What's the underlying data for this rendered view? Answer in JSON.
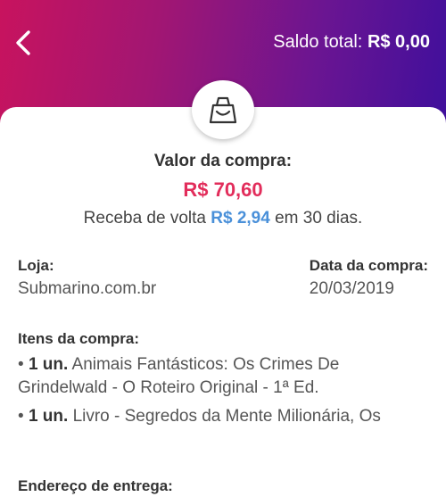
{
  "header": {
    "back_icon": "chevron-left-icon",
    "saldo_label": "Saldo total:",
    "saldo_value": "R$ 0,00",
    "gradient_colors": [
      "#c8135e",
      "#6a1592",
      "#3f0f9c"
    ]
  },
  "badge": {
    "icon": "shopping-bag-icon"
  },
  "summary": {
    "label": "Valor da compra:",
    "total": "R$ 70,60",
    "cashback_prefix": "Receba de volta",
    "cashback_amount": "R$ 2,94",
    "cashback_suffix": "em 30 dias.",
    "total_color": "#e22d5b",
    "cashback_color": "#4a90d9"
  },
  "store": {
    "label": "Loja:",
    "value": "Submarino.com.br"
  },
  "purchase_date": {
    "label": "Data da compra:",
    "value": "20/03/2019"
  },
  "items": {
    "title": "Itens da compra:",
    "list": [
      {
        "bullet": "•",
        "qty": "1 un.",
        "name": "Animais Fantásticos: Os Crimes De Grindelwald - O Roteiro Original - 1ª Ed."
      },
      {
        "bullet": "•",
        "qty": "1 un.",
        "name": "Livro - Segredos da Mente Milionária, Os"
      }
    ]
  },
  "address": {
    "title": "Endereço de entrega:"
  }
}
